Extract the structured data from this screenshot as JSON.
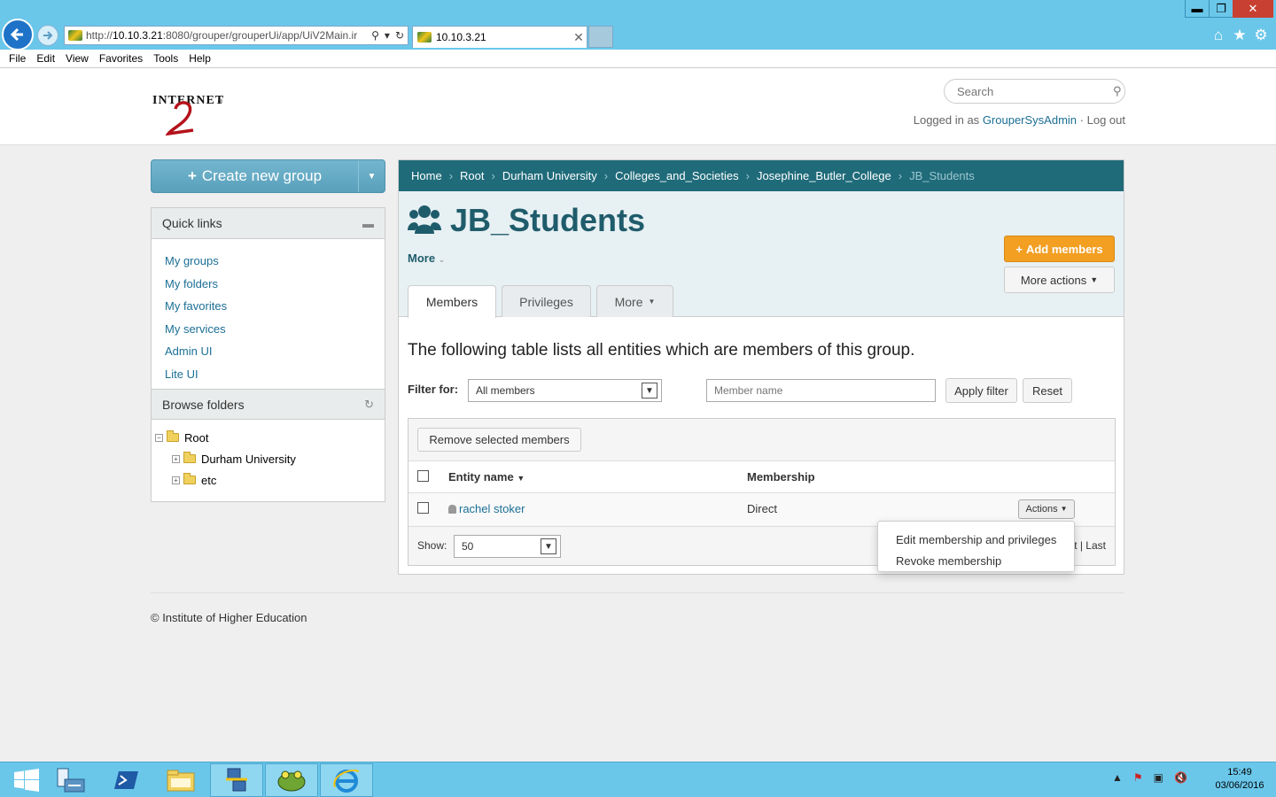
{
  "browser": {
    "url_prefix": "http://",
    "url_host": "10.10.3.21",
    "url_rest": ":8080/grouper/grouperUi/app/UiV2Main.ir",
    "tab_title": "10.10.3.21",
    "menu": [
      "File",
      "Edit",
      "View",
      "Favorites",
      "Tools",
      "Help"
    ]
  },
  "header": {
    "search_placeholder": "Search",
    "logged_in_prefix": "Logged in as",
    "username": "GrouperSysAdmin",
    "separator": "·",
    "logout": "Log out"
  },
  "sidebar": {
    "create_group": "Create new group",
    "quick_links_title": "Quick links",
    "quick_links": [
      "My groups",
      "My folders",
      "My favorites",
      "My services",
      "Admin UI",
      "Lite UI"
    ],
    "browse_title": "Browse folders",
    "tree": {
      "root": "Root",
      "children": [
        "Durham University",
        "etc"
      ]
    }
  },
  "breadcrumb": [
    "Home",
    "Root",
    "Durham University",
    "Colleges_and_Societies",
    "Josephine_Butler_College",
    "JB_Students"
  ],
  "group": {
    "title": "JB_Students",
    "more": "More",
    "add_members": "Add members",
    "more_actions": "More actions"
  },
  "tabs": [
    "Members",
    "Privileges",
    "More"
  ],
  "members": {
    "intro": "The following table lists all entities which are members of this group.",
    "filter_label": "Filter for:",
    "filter_value": "All members",
    "member_name_placeholder": "Member name",
    "apply_filter": "Apply filter",
    "reset": "Reset",
    "remove_selected": "Remove selected members",
    "columns": [
      "Entity name",
      "Membership"
    ],
    "rows": [
      {
        "name": "rachel stoker",
        "membership": "Direct",
        "actions": "Actions"
      }
    ],
    "show_label": "Show:",
    "page_size": "50",
    "pager_visible": "t | Last"
  },
  "actions_menu": [
    "Edit membership and privileges",
    "Revoke membership"
  ],
  "footer": "© Institute of Higher Education",
  "taskbar": {
    "time": "15:49",
    "date": "03/06/2016"
  },
  "colors": {
    "accent": "#1f6b7a",
    "brand_button": "#5aa0bb",
    "add_members": "#f29f22",
    "taskbar": "#6ac7ea"
  }
}
